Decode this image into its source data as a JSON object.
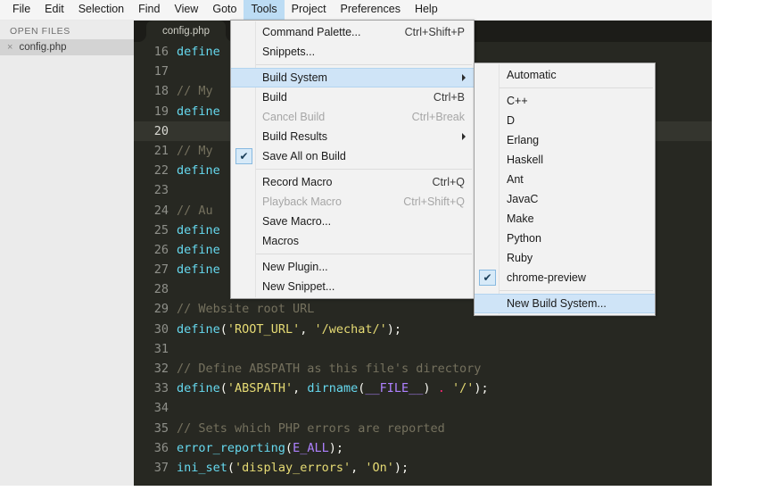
{
  "app": {
    "window_bg": "#2e2e29",
    "editor_bg": "#272822",
    "accent": "#bcdcf4"
  },
  "menubar": {
    "items": [
      {
        "label": "File",
        "active": false
      },
      {
        "label": "Edit",
        "active": false
      },
      {
        "label": "Selection",
        "active": false
      },
      {
        "label": "Find",
        "active": false
      },
      {
        "label": "View",
        "active": false
      },
      {
        "label": "Goto",
        "active": false
      },
      {
        "label": "Tools",
        "active": true
      },
      {
        "label": "Project",
        "active": false
      },
      {
        "label": "Preferences",
        "active": false
      },
      {
        "label": "Help",
        "active": false
      }
    ]
  },
  "sidebar": {
    "title": "OPEN FILES",
    "close_icon": "×",
    "file": "config.php"
  },
  "editor": {
    "tab_label": "config.php",
    "lines": [
      {
        "n": "16",
        "highlight": false,
        "tokens": [
          {
            "c": "t-fn",
            "t": "define"
          }
        ]
      },
      {
        "n": "17",
        "highlight": false,
        "tokens": []
      },
      {
        "n": "18",
        "highlight": false,
        "tokens": [
          {
            "c": "t-com",
            "t": "// My"
          }
        ]
      },
      {
        "n": "19",
        "highlight": false,
        "tokens": [
          {
            "c": "t-fn",
            "t": "define"
          }
        ]
      },
      {
        "n": "20",
        "highlight": true,
        "tokens": []
      },
      {
        "n": "21",
        "highlight": false,
        "tokens": [
          {
            "c": "t-com",
            "t": "// My"
          }
        ]
      },
      {
        "n": "22",
        "highlight": false,
        "tokens": [
          {
            "c": "t-fn",
            "t": "define"
          }
        ]
      },
      {
        "n": "23",
        "highlight": false,
        "tokens": []
      },
      {
        "n": "24",
        "highlight": false,
        "tokens": [
          {
            "c": "t-com",
            "t": "// Au"
          }
        ]
      },
      {
        "n": "25",
        "highlight": false,
        "tokens": [
          {
            "c": "t-fn",
            "t": "define"
          }
        ]
      },
      {
        "n": "26",
        "highlight": false,
        "tokens": [
          {
            "c": "t-fn",
            "t": "define"
          }
        ]
      },
      {
        "n": "27",
        "highlight": false,
        "tokens": [
          {
            "c": "t-fn",
            "t": "define"
          }
        ]
      },
      {
        "n": "28",
        "highlight": false,
        "tokens": []
      },
      {
        "n": "29",
        "highlight": false,
        "tokens": [
          {
            "c": "t-com",
            "t": "// Website root URL"
          }
        ]
      },
      {
        "n": "30",
        "highlight": false,
        "tokens": [
          {
            "c": "t-fn",
            "t": "define"
          },
          {
            "c": "t-pun",
            "t": "("
          },
          {
            "c": "t-str",
            "t": "'ROOT_URL'"
          },
          {
            "c": "t-pun",
            "t": ", "
          },
          {
            "c": "t-str",
            "t": "'/wechat/'"
          },
          {
            "c": "t-pun",
            "t": ");"
          }
        ]
      },
      {
        "n": "31",
        "highlight": false,
        "tokens": []
      },
      {
        "n": "32",
        "highlight": false,
        "tokens": [
          {
            "c": "t-com",
            "t": "// Define ABSPATH as this file's directory"
          }
        ]
      },
      {
        "n": "33",
        "highlight": false,
        "tokens": [
          {
            "c": "t-fn",
            "t": "define"
          },
          {
            "c": "t-pun",
            "t": "("
          },
          {
            "c": "t-str",
            "t": "'ABSPATH'"
          },
          {
            "c": "t-pun",
            "t": ", "
          },
          {
            "c": "t-fn",
            "t": "dirname"
          },
          {
            "c": "t-pun",
            "t": "("
          },
          {
            "c": "t-cst",
            "t": "__FILE__"
          },
          {
            "c": "t-pun",
            "t": ") "
          },
          {
            "c": "t-op",
            "t": "."
          },
          {
            "c": "t-pun",
            "t": " "
          },
          {
            "c": "t-str",
            "t": "'/'"
          },
          {
            "c": "t-pun",
            "t": ");"
          }
        ]
      },
      {
        "n": "34",
        "highlight": false,
        "tokens": []
      },
      {
        "n": "35",
        "highlight": false,
        "tokens": [
          {
            "c": "t-com",
            "t": "// Sets which PHP errors are reported"
          }
        ]
      },
      {
        "n": "36",
        "highlight": false,
        "tokens": [
          {
            "c": "t-fn",
            "t": "error_reporting"
          },
          {
            "c": "t-pun",
            "t": "("
          },
          {
            "c": "t-cst",
            "t": "E_ALL"
          },
          {
            "c": "t-pun",
            "t": ");"
          }
        ]
      },
      {
        "n": "37",
        "highlight": false,
        "tokens": [
          {
            "c": "t-fn",
            "t": "ini_set"
          },
          {
            "c": "t-pun",
            "t": "("
          },
          {
            "c": "t-str",
            "t": "'display_errors'"
          },
          {
            "c": "t-pun",
            "t": ", "
          },
          {
            "c": "t-str",
            "t": "'On'"
          },
          {
            "c": "t-pun",
            "t": ");"
          }
        ]
      }
    ]
  },
  "tools_menu": {
    "items": [
      {
        "type": "item",
        "label": "Command Palette...",
        "accel": "Ctrl+Shift+P"
      },
      {
        "type": "item",
        "label": "Snippets...",
        "accel": ""
      },
      {
        "type": "sep"
      },
      {
        "type": "item",
        "label": "Build System",
        "accel": "",
        "submenu": true,
        "selected": true
      },
      {
        "type": "item",
        "label": "Build",
        "accel": "Ctrl+B"
      },
      {
        "type": "item",
        "label": "Cancel Build",
        "accel": "Ctrl+Break",
        "disabled": true
      },
      {
        "type": "item",
        "label": "Build Results",
        "accel": "",
        "submenu": true
      },
      {
        "type": "item",
        "label": "Save All on Build",
        "accel": "",
        "checked": true
      },
      {
        "type": "sep"
      },
      {
        "type": "item",
        "label": "Record Macro",
        "accel": "Ctrl+Q"
      },
      {
        "type": "item",
        "label": "Playback Macro",
        "accel": "Ctrl+Shift+Q",
        "disabled": true
      },
      {
        "type": "item",
        "label": "Save Macro...",
        "accel": ""
      },
      {
        "type": "item",
        "label": "Macros",
        "accel": ""
      },
      {
        "type": "sep"
      },
      {
        "type": "item",
        "label": "New Plugin...",
        "accel": ""
      },
      {
        "type": "item",
        "label": "New Snippet...",
        "accel": ""
      }
    ]
  },
  "build_system_menu": {
    "items": [
      {
        "type": "item",
        "label": "Automatic"
      },
      {
        "type": "sep"
      },
      {
        "type": "item",
        "label": "C++"
      },
      {
        "type": "item",
        "label": "D"
      },
      {
        "type": "item",
        "label": "Erlang"
      },
      {
        "type": "item",
        "label": "Haskell"
      },
      {
        "type": "item",
        "label": "Ant"
      },
      {
        "type": "item",
        "label": "JavaC"
      },
      {
        "type": "item",
        "label": "Make"
      },
      {
        "type": "item",
        "label": "Python"
      },
      {
        "type": "item",
        "label": "Ruby"
      },
      {
        "type": "item",
        "label": "chrome-preview",
        "checked": true
      },
      {
        "type": "sep"
      },
      {
        "type": "item",
        "label": "New Build System...",
        "selected": true
      }
    ]
  },
  "icons": {
    "checkmark": "✔"
  }
}
